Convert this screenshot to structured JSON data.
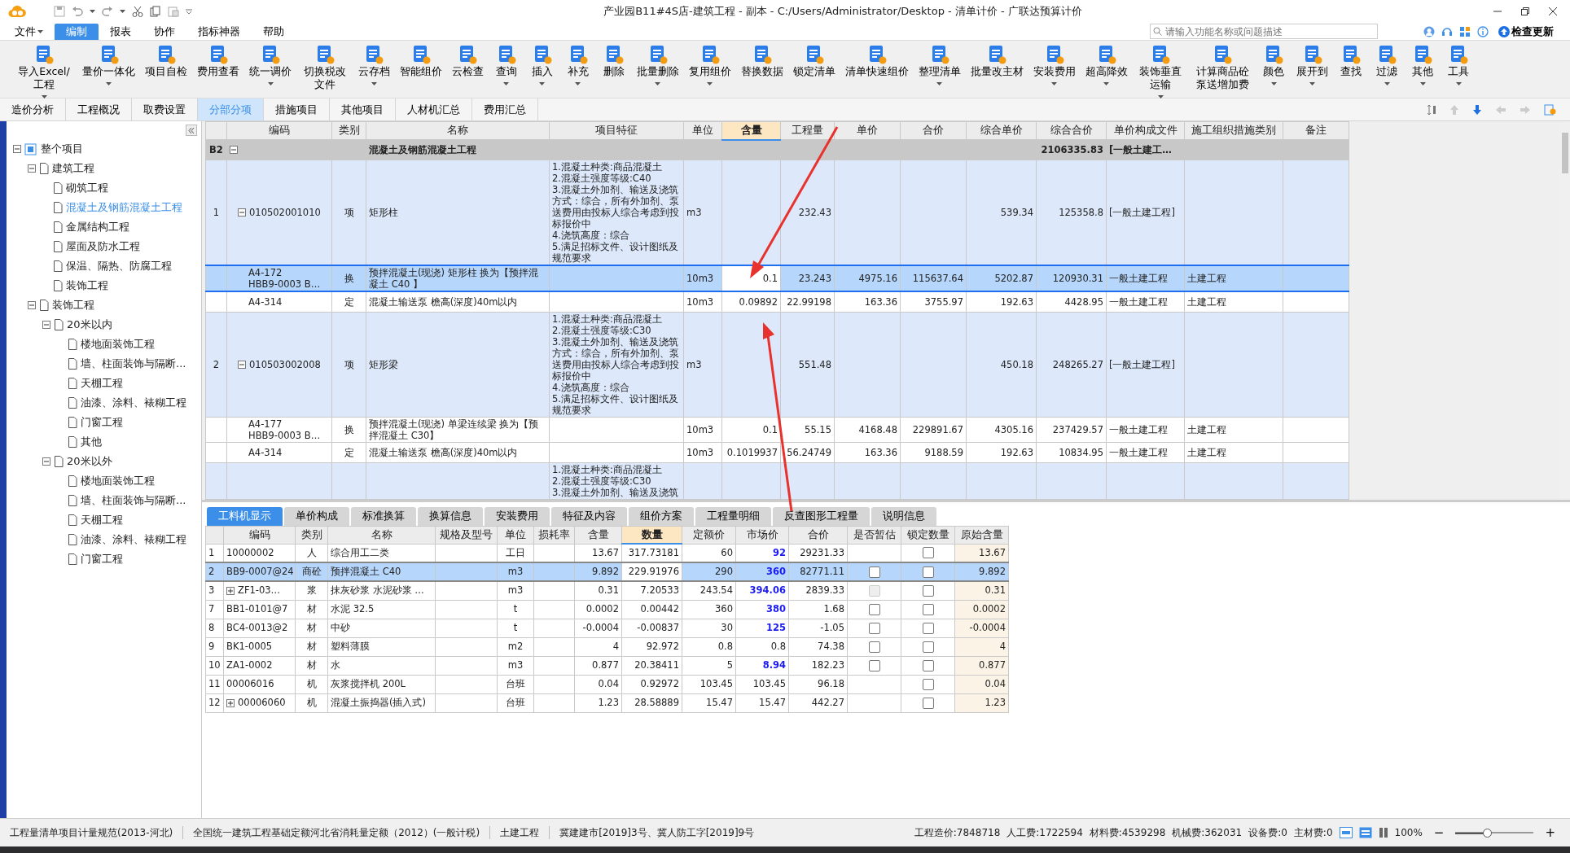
{
  "window": {
    "title": "产业园B11#4S店-建筑工程 - 副本 - C:/Users/Administrator/Desktop - 清单计价 - 广联达预算计价"
  },
  "menu": [
    {
      "label": "文件",
      "caret": true,
      "selected": false
    },
    {
      "label": "编制",
      "caret": false,
      "selected": true
    },
    {
      "label": "报表",
      "caret": false,
      "selected": false
    },
    {
      "label": "协作",
      "caret": false,
      "selected": false
    },
    {
      "label": "指标神器",
      "caret": false,
      "selected": false
    },
    {
      "label": "帮助",
      "caret": false,
      "selected": false
    }
  ],
  "search": {
    "placeholder": "请输入功能名称或问题描述"
  },
  "update_button": "检查更新",
  "toolbar": [
    {
      "label": "导入Excel/工程",
      "caret": true
    },
    {
      "label": "量价一体化",
      "caret": true
    },
    {
      "label": "项目自检",
      "caret": false
    },
    {
      "label": "费用查看",
      "caret": false
    },
    {
      "label": "统一调价",
      "caret": true
    },
    {
      "label": "切换税改文件",
      "caret": false
    },
    {
      "label": "云存档",
      "caret": true
    },
    {
      "label": "智能组价",
      "caret": false
    },
    {
      "label": "云检查",
      "caret": false
    },
    {
      "label": "查询",
      "caret": true
    },
    {
      "label": "插入",
      "caret": true
    },
    {
      "label": "补充",
      "caret": true
    },
    {
      "label": "删除",
      "caret": false
    },
    {
      "label": "批量删除",
      "caret": true
    },
    {
      "label": "复用组价",
      "caret": true
    },
    {
      "label": "替换数据",
      "caret": false
    },
    {
      "label": "锁定清单",
      "caret": false
    },
    {
      "label": "清单快速组价",
      "caret": false
    },
    {
      "label": "整理清单",
      "caret": true
    },
    {
      "label": "批量改主材",
      "caret": false
    },
    {
      "label": "安装费用",
      "caret": true
    },
    {
      "label": "超高降效",
      "caret": true
    },
    {
      "label": "装饰垂直运输",
      "caret": true
    },
    {
      "label": "计算商品砼泵送增加费",
      "caret": false
    },
    {
      "label": "颜色",
      "caret": true
    },
    {
      "label": "展开到",
      "caret": true
    },
    {
      "label": "查找",
      "caret": false
    },
    {
      "label": "过滤",
      "caret": true
    },
    {
      "label": "其他",
      "caret": true
    },
    {
      "label": "工具",
      "caret": true
    }
  ],
  "tabs": [
    {
      "label": "造价分析",
      "selected": false
    },
    {
      "label": "工程概况",
      "selected": false
    },
    {
      "label": "取费设置",
      "selected": false
    },
    {
      "label": "分部分项",
      "selected": true
    },
    {
      "label": "措施项目",
      "selected": false
    },
    {
      "label": "其他项目",
      "selected": false
    },
    {
      "label": "人材机汇总",
      "selected": false
    },
    {
      "label": "费用汇总",
      "selected": false
    }
  ],
  "tree": {
    "label": "整个项目",
    "expanded": true,
    "selected": false,
    "children": [
      {
        "label": "建筑工程",
        "expanded": true,
        "selected": false,
        "children": [
          {
            "label": "砌筑工程",
            "selected": false
          },
          {
            "label": "混凝土及钢筋混凝土工程",
            "selected": true
          },
          {
            "label": "金属结构工程",
            "selected": false
          },
          {
            "label": "屋面及防水工程",
            "selected": false
          },
          {
            "label": "保温、隔热、防腐工程",
            "selected": false
          },
          {
            "label": "装饰工程",
            "selected": false
          }
        ]
      },
      {
        "label": "装饰工程",
        "expanded": true,
        "selected": false,
        "children": [
          {
            "label": "20米以内",
            "expanded": true,
            "selected": false,
            "children": [
              {
                "label": "楼地面装饰工程",
                "selected": false
              },
              {
                "label": "墙、柱面装饰与隔断...",
                "selected": false
              },
              {
                "label": "天棚工程",
                "selected": false
              },
              {
                "label": "油漆、涂料、裱糊工程",
                "selected": false
              },
              {
                "label": "门窗工程",
                "selected": false
              },
              {
                "label": "其他",
                "selected": false
              }
            ]
          },
          {
            "label": "20米以外",
            "expanded": true,
            "selected": false,
            "children": [
              {
                "label": "楼地面装饰工程",
                "selected": false
              },
              {
                "label": "墙、柱面装饰与隔断...",
                "selected": false
              },
              {
                "label": "天棚工程",
                "selected": false
              },
              {
                "label": "油漆、涂料、裱糊工程",
                "selected": false
              },
              {
                "label": "门窗工程",
                "selected": false
              }
            ]
          }
        ]
      }
    ]
  },
  "upper_table": {
    "columns": [
      {
        "label": "编码",
        "selected": false
      },
      {
        "label": "类别",
        "selected": false
      },
      {
        "label": "名称",
        "selected": false
      },
      {
        "label": "项目特征",
        "selected": false
      },
      {
        "label": "单位",
        "selected": false
      },
      {
        "label": "含量",
        "selected": true
      },
      {
        "label": "工程量",
        "selected": false
      },
      {
        "label": "单价",
        "selected": false
      },
      {
        "label": "合价",
        "selected": false
      },
      {
        "label": "综合单价",
        "selected": false
      },
      {
        "label": "综合合价",
        "selected": false
      },
      {
        "label": "单价构成文件",
        "selected": false
      },
      {
        "label": "施工组织措施类别",
        "selected": false
      },
      {
        "label": "备注",
        "selected": false
      }
    ],
    "rows": [
      {
        "kind": "section",
        "num": "B2",
        "expanded": true,
        "name": "混凝土及钢筋混凝土工程",
        "comp_total": "2106335.83",
        "file": "[一般土建工…",
        "selected": false
      },
      {
        "kind": "item",
        "num": "1",
        "expanded": true,
        "code": "010502001010",
        "type": "项",
        "name": "矩形柱",
        "features": "1.混凝土种类:商品混凝土\n2.混凝土强度等级:C40\n3.混凝土外加剂、输送及浇筑方式：综合，所有外加剂、泵送费用由投标人综合考虑到投标报价中\n4.浇筑高度：综合\n5.满足招标文件、设计图纸及规范要求",
        "unit": "m3",
        "qty": "232.43",
        "unit_total": "539.34",
        "comp_total": "125358.8",
        "file": "[一般土建工程]",
        "selected": false
      },
      {
        "kind": "sub",
        "code": "A4-172\nHBB9-0003 B…",
        "type": "换",
        "name": "预拌混凝土(现浇) 矩形柱  换为【预拌混凝土 C40 】",
        "unit": "10m3",
        "content": "0.1",
        "qty": "23.243",
        "price": "4975.16",
        "total": "115637.64",
        "unit_total": "5202.87",
        "comp_total": "120930.31",
        "file": "一般土建工程",
        "category": "土建工程",
        "selected": true
      },
      {
        "kind": "sub",
        "code": "A4-314",
        "type": "定",
        "name": "混凝土输送泵 檐高(深度)40m以内",
        "unit": "10m3",
        "content": "0.09892",
        "qty": "22.99198",
        "price": "163.36",
        "total": "3755.97",
        "unit_total": "192.63",
        "comp_total": "4428.95",
        "file": "一般土建工程",
        "category": "土建工程",
        "selected": false
      },
      {
        "kind": "item",
        "num": "2",
        "expanded": true,
        "code": "010503002008",
        "type": "项",
        "name": "矩形梁",
        "features": "1.混凝土种类:商品混凝土\n2.混凝土强度等级:C30\n3.混凝土外加剂、输送及浇筑方式：综合，所有外加剂、泵送费用由投标人综合考虑到投标报价中\n4.浇筑高度：综合\n5.满足招标文件、设计图纸及规范要求",
        "unit": "m3",
        "qty": "551.48",
        "unit_total": "450.18",
        "comp_total": "248265.27",
        "file": "[一般土建工程]",
        "selected": false
      },
      {
        "kind": "sub",
        "code": "A4-177\nHBB9-0003 B…",
        "type": "换",
        "name": "预拌混凝土(现浇) 单梁连续梁  换为【预拌混凝土 C30】",
        "unit": "10m3",
        "content": "0.1",
        "qty": "55.15",
        "price": "4168.48",
        "total": "229891.67",
        "unit_total": "4305.16",
        "comp_total": "237429.57",
        "file": "一般土建工程",
        "category": "土建工程",
        "selected": false
      },
      {
        "kind": "sub",
        "code": "A4-314",
        "type": "定",
        "name": "混凝土输送泵 檐高(深度)40m以内",
        "unit": "10m3",
        "content": "0.1019937",
        "qty": "56.24749",
        "price": "163.36",
        "total": "9188.59",
        "unit_total": "192.63",
        "comp_total": "10834.95",
        "file": "一般土建工程",
        "category": "土建工程",
        "selected": false
      },
      {
        "kind": "item",
        "features": "1.混凝土种类:商品混凝土\n2.混凝土强度等级:C30\n3.混凝土外加剂、输送及浇筑",
        "selected": false
      }
    ]
  },
  "lower_tabs": [
    {
      "label": "工料机显示",
      "selected": true
    },
    {
      "label": "单价构成",
      "selected": false
    },
    {
      "label": "标准换算",
      "selected": false
    },
    {
      "label": "换算信息",
      "selected": false
    },
    {
      "label": "安装费用",
      "selected": false
    },
    {
      "label": "特征及内容",
      "selected": false
    },
    {
      "label": "组价方案",
      "selected": false
    },
    {
      "label": "工程量明细",
      "selected": false
    },
    {
      "label": "反查图形工程量",
      "selected": false
    },
    {
      "label": "说明信息",
      "selected": false
    }
  ],
  "lower_table": {
    "columns": [
      {
        "label": "编码",
        "selected": false
      },
      {
        "label": "类别",
        "selected": false
      },
      {
        "label": "名称",
        "selected": false
      },
      {
        "label": "规格及型号",
        "selected": false
      },
      {
        "label": "单位",
        "selected": false
      },
      {
        "label": "损耗率",
        "selected": false
      },
      {
        "label": "含量",
        "selected": false
      },
      {
        "label": "数量",
        "selected": true
      },
      {
        "label": "定额价",
        "selected": false
      },
      {
        "label": "市场价",
        "selected": false
      },
      {
        "label": "合价",
        "selected": false
      },
      {
        "label": "是否暂估",
        "selected": false
      },
      {
        "label": "锁定数量",
        "selected": false
      },
      {
        "label": "原始含量",
        "selected": false
      }
    ],
    "rows": [
      {
        "num": "1",
        "code": "10000002",
        "type": "人",
        "name": "综合用工二类",
        "unit": "工日",
        "content": "13.67",
        "qty": "317.73181",
        "base_price": "60",
        "market_price": "92",
        "price_changed": true,
        "total": "29231.33",
        "lock_checked": false,
        "orig": "13.67",
        "selected": false
      },
      {
        "num": "2",
        "code": "BB9-0007@24",
        "type": "商砼",
        "name": "预拌混凝土 C40",
        "unit": "m3",
        "content": "9.892",
        "qty": "229.91976",
        "base_price": "290",
        "market_price": "360",
        "price_changed": true,
        "total": "82771.11",
        "estimate_checked": false,
        "estimate_disabled": false,
        "lock_checked": false,
        "orig": "9.892",
        "selected": true
      },
      {
        "num": "3",
        "expanded": false,
        "code": "ZF1-03…",
        "type": "浆",
        "name": "抹灰砂浆 水泥砂浆 …",
        "unit": "m3",
        "content": "0.31",
        "qty": "7.20533",
        "base_price": "243.54",
        "market_price": "394.06",
        "price_changed": true,
        "total": "2839.33",
        "estimate_checked": false,
        "estimate_disabled": true,
        "lock_checked": false,
        "orig": "0.31",
        "selected": false
      },
      {
        "num": "7",
        "code": "BB1-0101@7",
        "type": "材",
        "name": "水泥 32.5",
        "unit": "t",
        "content": "0.0002",
        "qty": "0.00442",
        "base_price": "360",
        "market_price": "380",
        "price_changed": true,
        "total": "1.68",
        "estimate_checked": false,
        "estimate_disabled": false,
        "lock_checked": false,
        "orig": "0.0002",
        "selected": false
      },
      {
        "num": "8",
        "code": "BC4-0013@2",
        "type": "材",
        "name": "中砂",
        "unit": "t",
        "content": "-0.0004",
        "qty": "-0.00837",
        "base_price": "30",
        "market_price": "125",
        "price_changed": true,
        "total": "-1.05",
        "estimate_checked": false,
        "estimate_disabled": false,
        "lock_checked": false,
        "orig": "-0.0004",
        "selected": false
      },
      {
        "num": "9",
        "code": "BK1-0005",
        "type": "材",
        "name": "塑料薄膜",
        "unit": "m2",
        "content": "4",
        "qty": "92.972",
        "base_price": "0.8",
        "market_price": "0.8",
        "price_changed": false,
        "total": "74.38",
        "estimate_checked": false,
        "estimate_disabled": false,
        "lock_checked": false,
        "orig": "4",
        "selected": false
      },
      {
        "num": "10",
        "code": "ZA1-0002",
        "type": "材",
        "name": "水",
        "unit": "m3",
        "content": "0.877",
        "qty": "20.38411",
        "base_price": "5",
        "market_price": "8.94",
        "price_changed": true,
        "total": "182.23",
        "estimate_checked": false,
        "estimate_disabled": false,
        "lock_checked": false,
        "orig": "0.877",
        "selected": false
      },
      {
        "num": "11",
        "code": "00006016",
        "type": "机",
        "name": "灰浆搅拌机 200L",
        "unit": "台班",
        "content": "0.04",
        "qty": "0.92972",
        "base_price": "103.45",
        "market_price": "103.45",
        "price_changed": false,
        "total": "96.18",
        "lock_checked": false,
        "orig": "0.04",
        "selected": false
      },
      {
        "num": "12",
        "expanded": false,
        "code": "00006060",
        "type": "机",
        "name": "混凝土振捣器(插入式)",
        "unit": "台班",
        "content": "1.23",
        "qty": "28.58889",
        "base_price": "15.47",
        "market_price": "15.47",
        "price_changed": false,
        "total": "442.27",
        "lock_checked": false,
        "orig": "1.23",
        "selected": false
      }
    ]
  },
  "status_bar": {
    "left": [
      "工程量清单项目计量规范(2013-河北)",
      "全国统一建筑工程基础定额河北省消耗量定额（2012）(一般计税)",
      "土建工程",
      "冀建建市[2019]3号、冀人防工字[2019]9号"
    ],
    "right": [
      "工程造价:7848718",
      "人工费:1722594",
      "材料费:4539298",
      "机械费:362031",
      "设备费:0",
      "主材费:0"
    ],
    "zoom": "100%",
    "zoom_out": "−",
    "zoom_in": "+",
    "level": 0.4
  }
}
